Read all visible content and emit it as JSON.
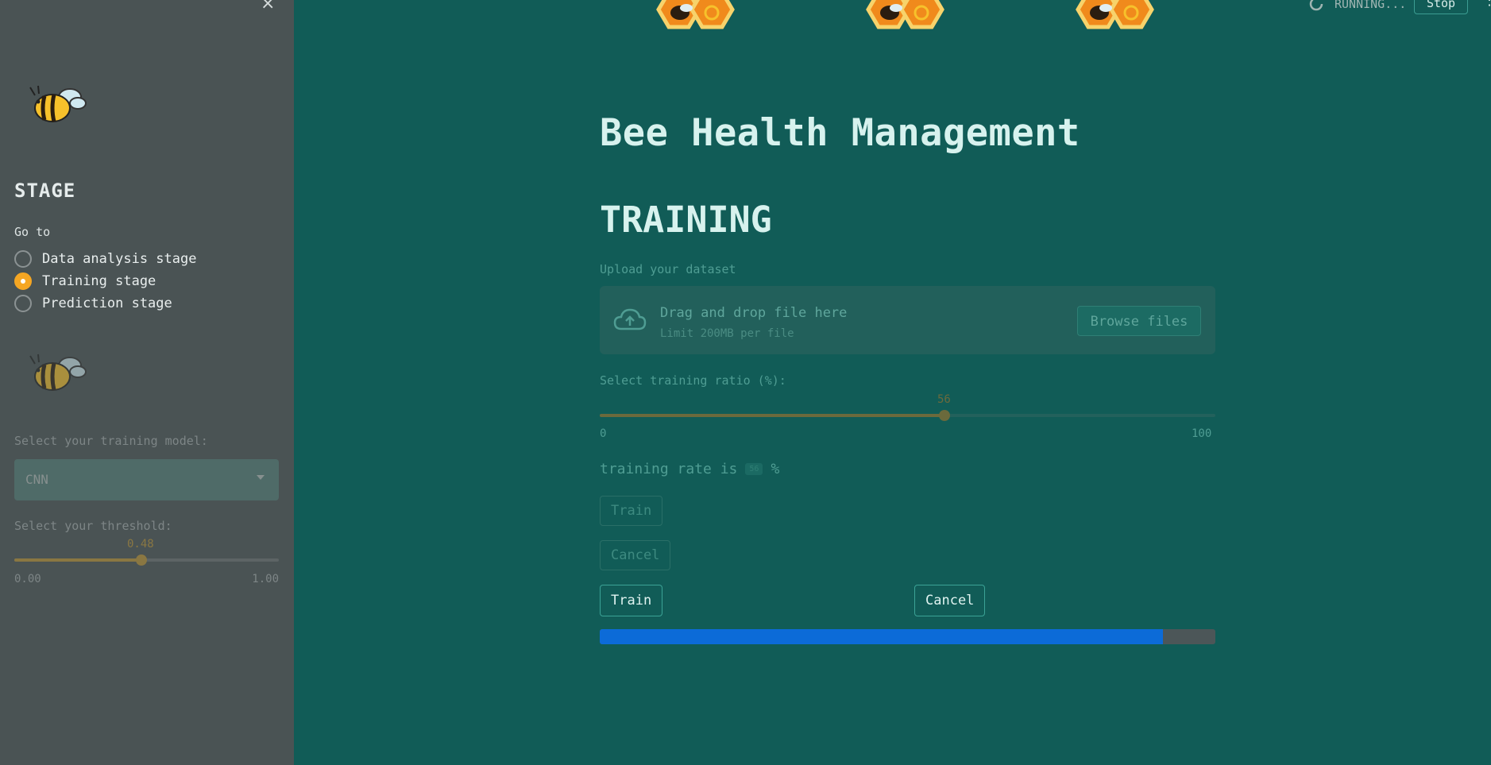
{
  "sidebar": {
    "close_label": "×",
    "stage_title": "STAGE",
    "goto_label": "Go to",
    "radio_options": [
      {
        "label": "Data analysis stage",
        "checked": false
      },
      {
        "label": "Training stage",
        "checked": true
      },
      {
        "label": "Prediction stage",
        "checked": false
      }
    ],
    "model_label": "Select your training model:",
    "model_value": "CNN",
    "threshold_label": "Select your threshold:",
    "threshold": {
      "value": "0.48",
      "min": "0.00",
      "max": "1.00",
      "fraction": 0.48
    }
  },
  "header": {
    "status_text": "RUNNING...",
    "stop_label": "Stop",
    "edge_text": "⋮"
  },
  "main": {
    "title": "Bee Health Management",
    "section": "TRAINING",
    "upload": {
      "label": "Upload your dataset",
      "dropzone_main": "Drag and drop file here",
      "dropzone_sub": "Limit 200MB per file",
      "browse_label": "Browse files"
    },
    "ratio": {
      "label": "Select training ratio (%):",
      "value": "56",
      "min": "0",
      "max": "100",
      "fraction": 0.56
    },
    "rate_prefix": "training rate is",
    "rate_value": "56",
    "rate_suffix": "%",
    "ghost_train": "Train",
    "ghost_cancel": "Cancel",
    "train_label": "Train",
    "cancel_label": "Cancel",
    "progress_fraction": 0.915
  },
  "colors": {
    "accent_orange": "#f5a623",
    "progress_blue": "#0c6bd8",
    "background": "#115c57",
    "sidebar": "#4a5354"
  }
}
